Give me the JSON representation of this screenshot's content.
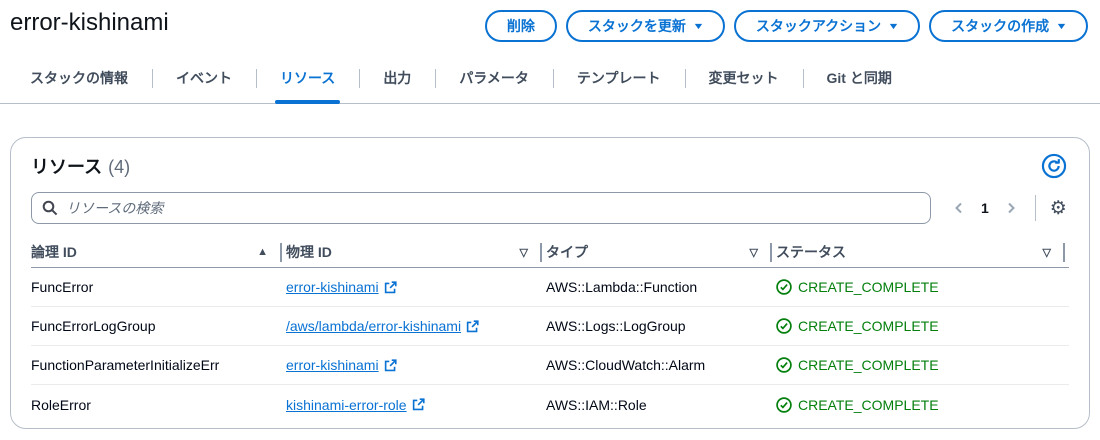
{
  "header": {
    "title": "error-kishinami",
    "buttons": {
      "delete": "削除",
      "update_stack": "スタックを更新",
      "stack_actions": "スタックアクション",
      "create_stack": "スタックの作成"
    }
  },
  "tabs": [
    {
      "label": "スタックの情報"
    },
    {
      "label": "イベント"
    },
    {
      "label": "リソース",
      "active": true
    },
    {
      "label": "出力"
    },
    {
      "label": "パラメータ"
    },
    {
      "label": "テンプレート"
    },
    {
      "label": "変更セット"
    },
    {
      "label": "Git と同期"
    }
  ],
  "panel": {
    "title": "リソース",
    "count": "(4)",
    "search": {
      "placeholder": "リソースの検索"
    },
    "pagination": {
      "current_page": "1"
    }
  },
  "table": {
    "columns": [
      {
        "label": "論理 ID",
        "sort": "ascending"
      },
      {
        "label": "物理 ID",
        "sort": "none"
      },
      {
        "label": "タイプ",
        "sort": "none"
      },
      {
        "label": "ステータス",
        "sort": "none"
      }
    ],
    "rows": [
      {
        "logical_id": "FuncError",
        "physical_id": "error-kishinami",
        "type": "AWS::Lambda::Function",
        "status": "CREATE_COMPLETE"
      },
      {
        "logical_id": "FuncErrorLogGroup",
        "physical_id": "/aws/lambda/error-kishinami",
        "type": "AWS::Logs::LogGroup",
        "status": "CREATE_COMPLETE"
      },
      {
        "logical_id": "FunctionParameterInitializeErr",
        "physical_id": "error-kishinami",
        "type": "AWS::CloudWatch::Alarm",
        "status": "CREATE_COMPLETE"
      },
      {
        "logical_id": "RoleError",
        "physical_id": "kishinami-error-role",
        "type": "AWS::IAM::Role",
        "status": "CREATE_COMPLETE"
      }
    ]
  },
  "icons": {
    "caret_down": "▼",
    "sort_ascending": "▲",
    "sort_default": "▽",
    "gear": "⚙"
  },
  "colors": {
    "accent_blue": "#0972d3",
    "success_green": "#037f0c"
  }
}
